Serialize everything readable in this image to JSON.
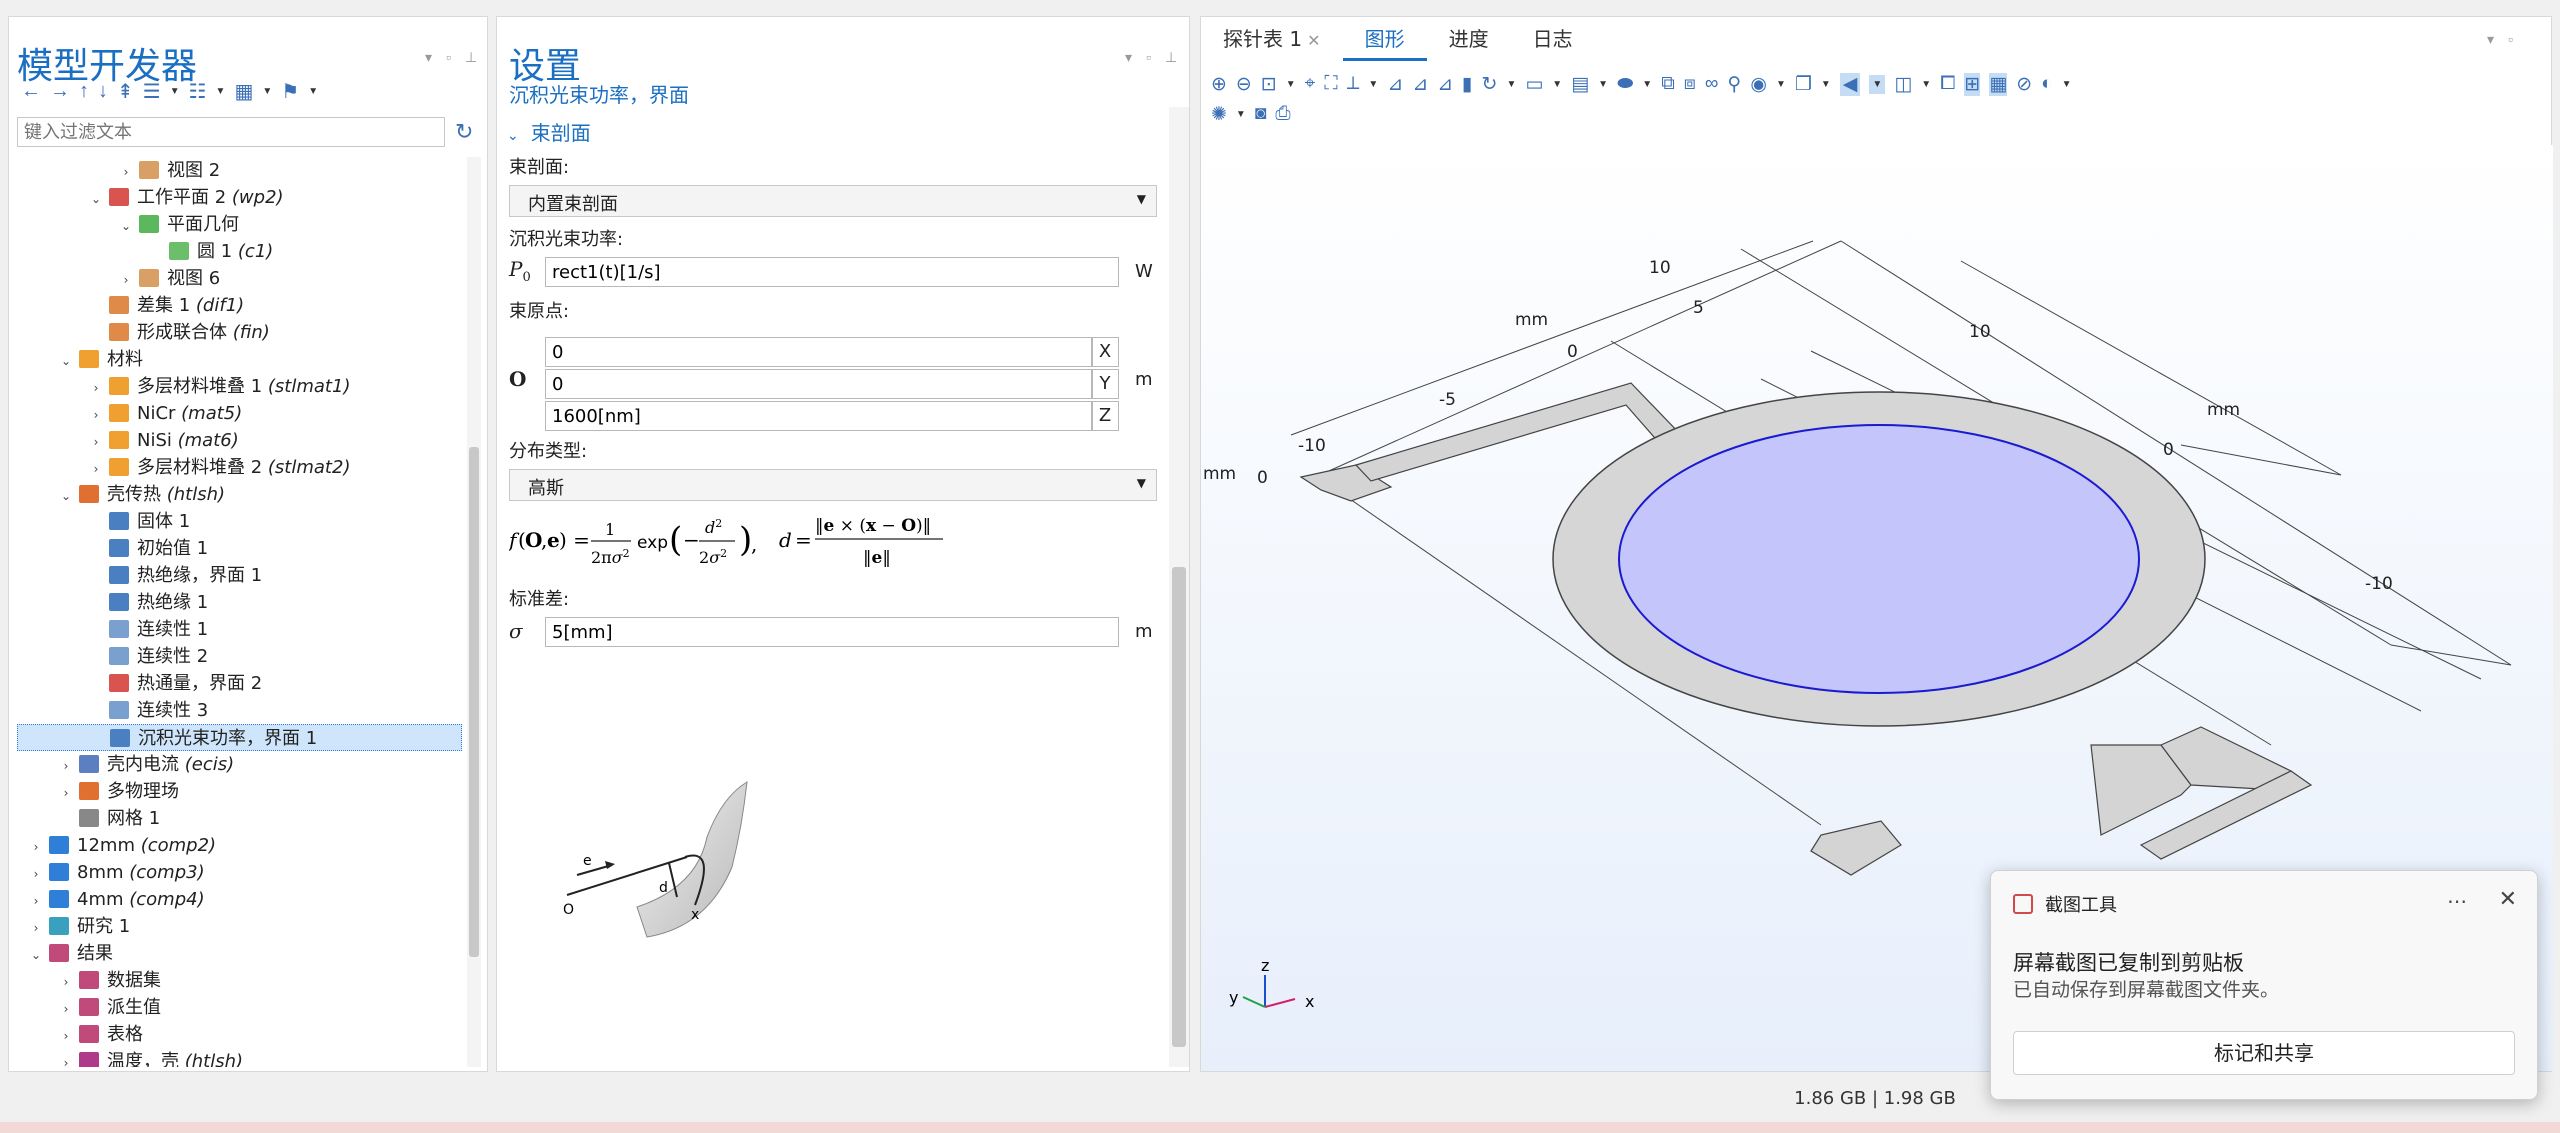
{
  "model_builder": {
    "title": "模型开发器",
    "filter_placeholder": "键入过滤文本",
    "tree": [
      {
        "label": "视图 2",
        "tag": "",
        "indent": 4,
        "arrow": "›",
        "color": "#d9a066"
      },
      {
        "label": "工作平面 2 ",
        "tag": "(wp2)",
        "indent": 3,
        "arrow": "⌄",
        "color": "#d9534f"
      },
      {
        "label": "平面几何",
        "tag": "",
        "indent": 4,
        "arrow": "⌄",
        "color": "#5cb85c"
      },
      {
        "label": "圆 1 ",
        "tag": "(c1)",
        "indent": 5,
        "arrow": "",
        "color": "#6bbf6b"
      },
      {
        "label": "视图 6",
        "tag": "",
        "indent": 4,
        "arrow": "›",
        "color": "#d9a066"
      },
      {
        "label": "差集 1 ",
        "tag": "(dif1)",
        "indent": 3,
        "arrow": "",
        "color": "#e08a4a"
      },
      {
        "label": "形成联合体 ",
        "tag": "(fin)",
        "indent": 3,
        "arrow": "",
        "color": "#e08a4a"
      },
      {
        "label": "材料",
        "tag": "",
        "indent": 2,
        "arrow": "⌄",
        "color": "#f0a030"
      },
      {
        "label": "多层材料堆叠 1 ",
        "tag": "(stlmat1)",
        "indent": 3,
        "arrow": "›",
        "color": "#f0a030"
      },
      {
        "label": "NiCr ",
        "tag": "(mat5)",
        "indent": 3,
        "arrow": "›",
        "color": "#f0a030"
      },
      {
        "label": "NiSi ",
        "tag": "(mat6)",
        "indent": 3,
        "arrow": "›",
        "color": "#f0a030"
      },
      {
        "label": "多层材料堆叠 2 ",
        "tag": "(stlmat2)",
        "indent": 3,
        "arrow": "›",
        "color": "#f0a030"
      },
      {
        "label": "壳传热 ",
        "tag": "(htlsh)",
        "indent": 2,
        "arrow": "⌄",
        "color": "#e07030"
      },
      {
        "label": "固体 1",
        "tag": "",
        "indent": 3,
        "arrow": "",
        "color": "#4a7fc1"
      },
      {
        "label": "初始值 1",
        "tag": "",
        "indent": 3,
        "arrow": "",
        "color": "#4a7fc1"
      },
      {
        "label": "热绝缘，界面 1",
        "tag": "",
        "indent": 3,
        "arrow": "",
        "color": "#4a7fc1"
      },
      {
        "label": "热绝缘 1",
        "tag": "",
        "indent": 3,
        "arrow": "",
        "color": "#4a7fc1"
      },
      {
        "label": "连续性 1",
        "tag": "",
        "indent": 3,
        "arrow": "",
        "color": "#7aa0d0"
      },
      {
        "label": "连续性 2",
        "tag": "",
        "indent": 3,
        "arrow": "",
        "color": "#7aa0d0"
      },
      {
        "label": "热通量，界面 2",
        "tag": "",
        "indent": 3,
        "arrow": "",
        "color": "#d9534f"
      },
      {
        "label": "连续性 3",
        "tag": "",
        "indent": 3,
        "arrow": "",
        "color": "#7aa0d0"
      },
      {
        "label": "沉积光束功率，界面 1",
        "tag": "",
        "indent": 3,
        "arrow": "",
        "color": "#4a7fc1",
        "selected": true
      },
      {
        "label": "壳内电流 ",
        "tag": "(ecis)",
        "indent": 2,
        "arrow": "›",
        "color": "#5b7fc0"
      },
      {
        "label": "多物理场",
        "tag": "",
        "indent": 2,
        "arrow": "›",
        "color": "#e07030"
      },
      {
        "label": "网格 1",
        "tag": "",
        "indent": 2,
        "arrow": "",
        "color": "#888888"
      },
      {
        "label": "12mm ",
        "tag": "(comp2)",
        "indent": 1,
        "arrow": "›",
        "color": "#2f7ed8"
      },
      {
        "label": "8mm ",
        "tag": "(comp3)",
        "indent": 1,
        "arrow": "›",
        "color": "#2f7ed8"
      },
      {
        "label": "4mm ",
        "tag": "(comp4)",
        "indent": 1,
        "arrow": "›",
        "color": "#2f7ed8"
      },
      {
        "label": "研究 1",
        "tag": "",
        "indent": 1,
        "arrow": "›",
        "color": "#3aa0c0"
      },
      {
        "label": "结果",
        "tag": "",
        "indent": 1,
        "arrow": "⌄",
        "color": "#c04a7a"
      },
      {
        "label": "数据集",
        "tag": "",
        "indent": 2,
        "arrow": "›",
        "color": "#c04a7a"
      },
      {
        "label": "派生值",
        "tag": "",
        "indent": 2,
        "arrow": "›",
        "color": "#c04a7a"
      },
      {
        "label": "表格",
        "tag": "",
        "indent": 2,
        "arrow": "›",
        "color": "#c04a7a"
      },
      {
        "label": "温度，壳 ",
        "tag": "(htlsh)",
        "indent": 2,
        "arrow": "›",
        "color": "#b03a8a"
      }
    ]
  },
  "settings": {
    "title": "设置",
    "subtitle": "沉积光束功率，界面",
    "section": "束剖面",
    "beam_profile_label": "束剖面:",
    "beam_profile_value": "内置束剖面",
    "power_label": "沉积光束功率:",
    "power_symbol": "P",
    "power_sub": "0",
    "power_value": "rect1(t)[1/s]",
    "power_unit": "W",
    "origin_label": "束原点:",
    "origin_symbol": "O",
    "origin": [
      {
        "value": "0",
        "comp": "X"
      },
      {
        "value": "0",
        "comp": "Y"
      },
      {
        "value": "1600[nm]",
        "comp": "Z"
      }
    ],
    "origin_unit": "m",
    "dist_label": "分布类型:",
    "dist_value": "高斯",
    "std_label": "标准差:",
    "std_symbol": "σ",
    "std_value": "5[mm]",
    "std_unit": "m",
    "figure_labels": {
      "e": "e",
      "d": "d",
      "o": "O",
      "x": "x"
    }
  },
  "graphics": {
    "tabs": [
      "探针表 1",
      "图形",
      "进度",
      "日志"
    ],
    "active_tab": "图形",
    "axis_labels": {
      "mm_top": "mm",
      "mm_right": "mm",
      "mm_left": "mm",
      "ticks_top": [
        "10",
        "5",
        "0",
        "-5",
        "-10"
      ],
      "ticks_right": [
        "10",
        "0",
        "-10"
      ],
      "tick_left": "0"
    },
    "triad": {
      "x": "x",
      "y": "y",
      "z": "z"
    },
    "colors": {
      "disk": "#c4c6fb",
      "ring": "#d6d6d6",
      "edge": "#1a1ad0"
    }
  },
  "notification": {
    "app": "截图工具",
    "message": "屏幕截图已复制到剪贴板",
    "detail": "已自动保存到屏幕截图文件夹。",
    "action": "标记和共享"
  },
  "status": {
    "memory": "1.86 GB | 1.98 GB"
  }
}
